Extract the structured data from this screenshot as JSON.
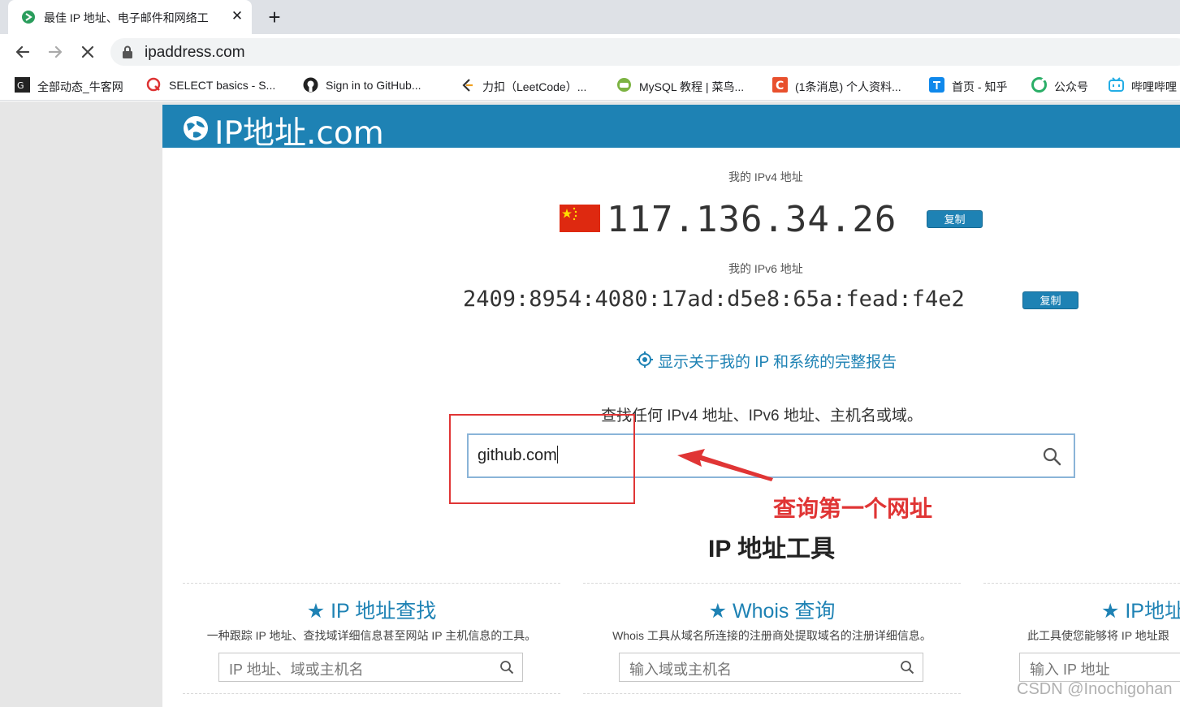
{
  "browser": {
    "tab": {
      "title": "最佳 IP 地址、电子邮件和网络工",
      "close": "✕"
    },
    "new_tab": "+",
    "url": "ipaddress.com",
    "bookmarks": [
      {
        "label": "全部动态_牛客网",
        "icon": "nowcoder-icon"
      },
      {
        "label": "SELECT basics - S...",
        "icon": "sqlzoo-icon"
      },
      {
        "label": "Sign in to GitHub...",
        "icon": "github-icon"
      },
      {
        "label": "力扣（LeetCode）...",
        "icon": "leetcode-icon"
      },
      {
        "label": "MySQL 教程 | 菜鸟...",
        "icon": "runoob-icon"
      },
      {
        "label": "(1条消息) 个人资料...",
        "icon": "csdn-icon"
      },
      {
        "label": "首页 - 知乎",
        "icon": "zhihu-icon"
      },
      {
        "label": "公众号",
        "icon": "wechat-icon"
      },
      {
        "label": "哔哩哔哩",
        "icon": "bilibili-icon"
      }
    ]
  },
  "site": {
    "brand": "IP地址.com",
    "ipv4_label": "我的 IPv4 地址",
    "ipv4_value": "117.136.34.26",
    "ipv6_label": "我的 IPv6 地址",
    "ipv6_value": "2409:8954:4080:17ad:d5e8:65a:fead:f4e2",
    "copy_label": "复制",
    "report_link": "显示关于我的 IP 和系统的完整报告",
    "search_hint": "查找任何 IPv4 地址、IPv6 地址、主机名或域。",
    "search_value": "github.com",
    "tools_title": "IP 地址工具",
    "tools": [
      {
        "title": "★ IP 地址查找",
        "desc": "一种跟踪 IP 地址、查找域详细信息甚至网站 IP 主机信息的工具。",
        "placeholder": "IP 地址、域或主机名"
      },
      {
        "title": "★ Whois 查询",
        "desc": "Whois 工具从域名所连接的注册商处提取域名的注册详细信息。",
        "placeholder": "输入域或主机名"
      },
      {
        "title": "★ IP地址",
        "desc": "此工具使您能够将 IP 地址跟",
        "placeholder": "输入 IP 地址"
      }
    ]
  },
  "annotation": {
    "text": "查询第一个网址",
    "color": "#e03535"
  },
  "watermark": "CSDN @Inochigohan",
  "colors": {
    "brand": "#1e82b4",
    "chrome_bg": "#dee1e6",
    "flag_red": "#de2910"
  }
}
